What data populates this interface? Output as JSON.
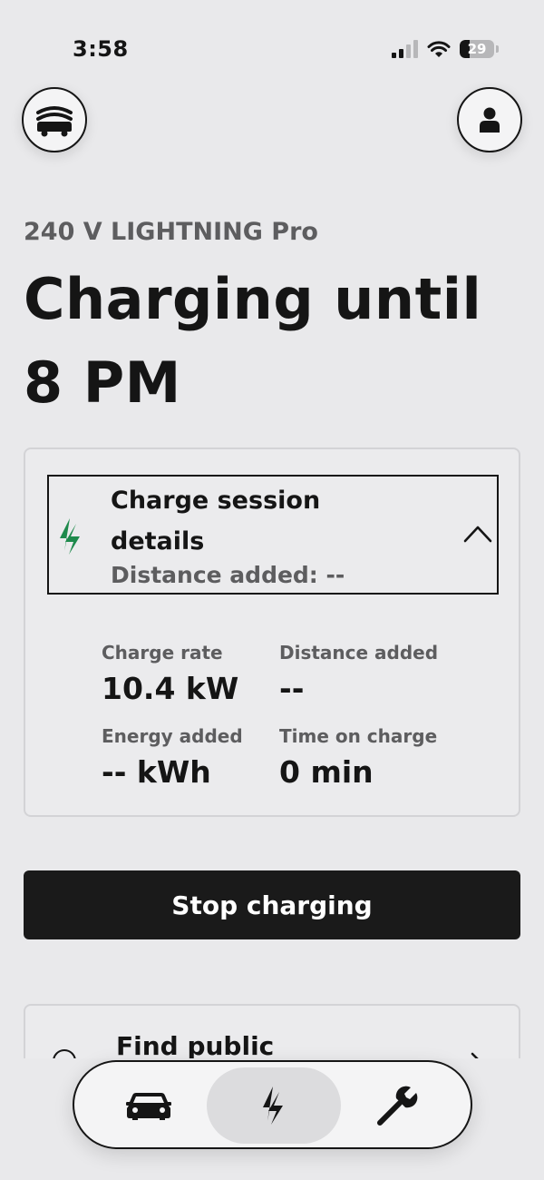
{
  "status_bar": {
    "time": "3:58",
    "battery_level": "29",
    "battery_fraction": 0.29,
    "icons": [
      "signal-icon",
      "wifi-icon",
      "battery-icon"
    ]
  },
  "header": {
    "left_button_icon": "garage-icon",
    "right_button_icon": "profile-icon"
  },
  "charger": {
    "name": "240 V LIGHTNING Pro",
    "headline": "Charging until 8 PM"
  },
  "session": {
    "title": "Charge session details",
    "subtitle": "Distance added: --",
    "icon": "bolt-icon",
    "expand_icon": "chevron-up-icon",
    "accent_color": "#1e8a4c",
    "stats": {
      "charge_rate": {
        "label": "Charge rate",
        "value": "10.4 kW"
      },
      "distance_added": {
        "label": "Distance added",
        "value": "--"
      },
      "energy_added": {
        "label": "Energy added",
        "value": "-- kWh"
      },
      "time_on_charge": {
        "label": "Time on charge",
        "value": "0 min"
      }
    }
  },
  "actions": {
    "stop_label": "Stop charging"
  },
  "find_public": {
    "title": "Find public"
  },
  "tab_bar": {
    "tabs": [
      {
        "name": "vehicle",
        "icon": "car-icon",
        "selected": false
      },
      {
        "name": "charge",
        "icon": "bolt-icon",
        "selected": true
      },
      {
        "name": "service",
        "icon": "wrench-icon",
        "selected": false
      }
    ]
  }
}
